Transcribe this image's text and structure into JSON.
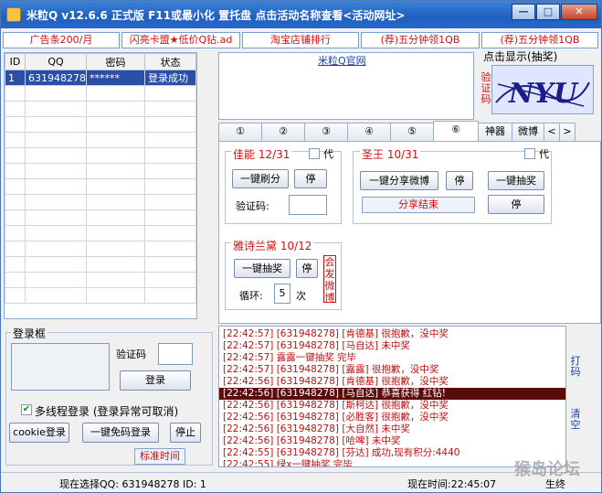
{
  "window": {
    "title": "米粒Q v12.6.6 正式版   F11或最小化 置托盘   点击活动名称查看<活动网址>",
    "min_label": "—",
    "max_label": "□",
    "close_label": "✕"
  },
  "ads": [
    "广告条200/月",
    "闪亮卡盟★低价Q钻.ad",
    "淘宝店铺排行",
    "(荐)五分钟领1QB",
    "(荐)五分钟领1QB"
  ],
  "accounts": {
    "columns": [
      "ID",
      "QQ",
      "密码",
      "状态"
    ],
    "rows": [
      {
        "id": "1",
        "qq": "631948278",
        "password": "******",
        "status": "登录成功"
      }
    ]
  },
  "site_link": "米粒Q官网",
  "captcha": {
    "header": "点击显示(抽奖)",
    "side_label": "验证码",
    "image_text": "NYU"
  },
  "tabs": [
    "①",
    "②",
    "③",
    "④",
    "⑤",
    "⑥",
    "神器",
    "微博"
  ],
  "tab_nav": {
    "prev": "<",
    "next": ">"
  },
  "jianeng": {
    "title": "佳能 12/31",
    "dai": "代",
    "brush_btn": "一键刷分",
    "stop_btn": "停",
    "captcha_label": "验证码:",
    "captcha_value": ""
  },
  "shengwang": {
    "title": "圣王 10/31",
    "dai": "代",
    "share_btn": "一键分享微博",
    "stop1": "停",
    "draw_btn": "一键抽奖",
    "stop2": "停",
    "share_status": "分享结束"
  },
  "yashi": {
    "title": "雅诗兰黛 10/12",
    "draw_btn": "一键抽奖",
    "stop_btn": "停",
    "loop_label": "循环:",
    "loop_value": "5",
    "loop_unit": "次",
    "side_text": "会发微博"
  },
  "login": {
    "group_title": "登录框",
    "captcha_label": "验证码",
    "login_btn": "登录",
    "multithread_label": "多线程登录 (登录异常可取消)",
    "multithread_checked": true,
    "cookie_btn": "cookie登录",
    "nocode_btn": "一键免码登录",
    "stop_btn": "停止",
    "std_time_btn": "标准时间"
  },
  "log": {
    "lines": [
      "[22:42:57] [631948278] [肯德基] 很抱歉，没中奖",
      "[22:42:57] [631948278] [马自达] 未中奖",
      "[22:42:57] 露露一键抽奖   完毕",
      "[22:42:57] [631948278] [露露] 很抱歉，没中奖",
      "[22:42:56] [631948278] [肯德基] 很抱歉，没中奖",
      "[22:42:56] [631948278] [马自达] 恭喜获得 红钻!",
      "[22:42:56] [631948278] [斯柯达] 很抱歉，没中奖",
      "[22:42:56] [631948278] [必胜客] 很抱歉，没中奖",
      "[22:42:56] [631948278] [大自然] 未中奖",
      "[22:42:56] [631948278] [哈啤] 未中奖",
      "[22:42:55] [631948278] [芬达] 成功,现有积分:4440",
      "[22:42:55] 绿x一键抽奖   完毕"
    ],
    "highlight_index": 5,
    "side_btn1": "打码",
    "side_btn2": "清空"
  },
  "status": {
    "current_qq": "现在选择QQ: 631948278  ID: 1",
    "current_time": "现在时间:22:45:07",
    "extra": "生终"
  },
  "watermark": "猴岛论坛"
}
